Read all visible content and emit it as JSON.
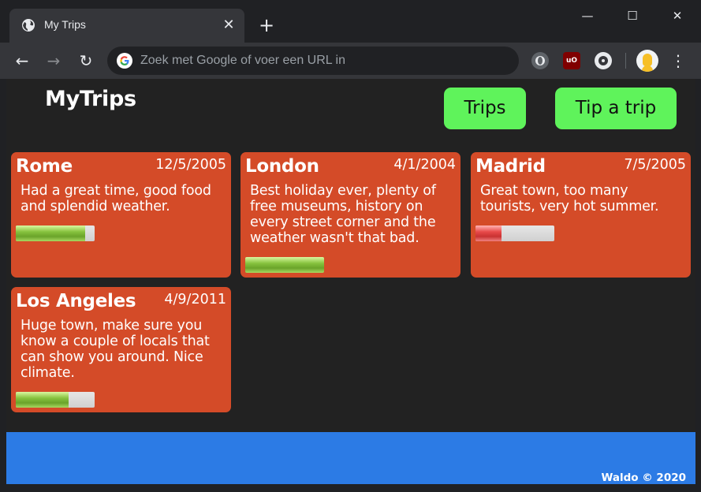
{
  "browser": {
    "tab_title": "My Trips",
    "omnibox_placeholder": "Zoek met Google of voer een URL in",
    "win_minimize": "—",
    "win_maximize": "☐",
    "win_close": "✕",
    "back": "←",
    "forward": "→",
    "reload": "↻",
    "tab_close": "✕",
    "new_tab": "+",
    "menu": "⋮"
  },
  "header": {
    "brand": "MyTrips",
    "nav": [
      {
        "label": "Trips"
      },
      {
        "label": "Tip a trip"
      }
    ]
  },
  "colors": {
    "card": "#d44b28",
    "nav_button": "#5ff35b",
    "footer": "#2c7be5",
    "page_bg": "#222222"
  },
  "trips": [
    {
      "city": "Rome",
      "date": "12/5/2005",
      "text": "Had a great time, good food and splendid weather.",
      "rating": 0.88,
      "rating_color": "good"
    },
    {
      "city": "London",
      "date": "4/1/2004",
      "text": "Best holiday ever, plenty of free museums, history on every street corner and the weather wasn't that bad.",
      "rating": 1.0,
      "rating_color": "good"
    },
    {
      "city": "Madrid",
      "date": "7/5/2005",
      "text": "Great town, too many tourists, very hot summer.",
      "rating": 0.33,
      "rating_color": "bad"
    },
    {
      "city": "Los Angeles",
      "date": "4/9/2011",
      "text": "Huge town, make sure you know a couple of locals that can show you around. Nice climate.",
      "rating": 0.67,
      "rating_color": "good"
    }
  ],
  "footer": {
    "text": "Waldo © 2020"
  }
}
